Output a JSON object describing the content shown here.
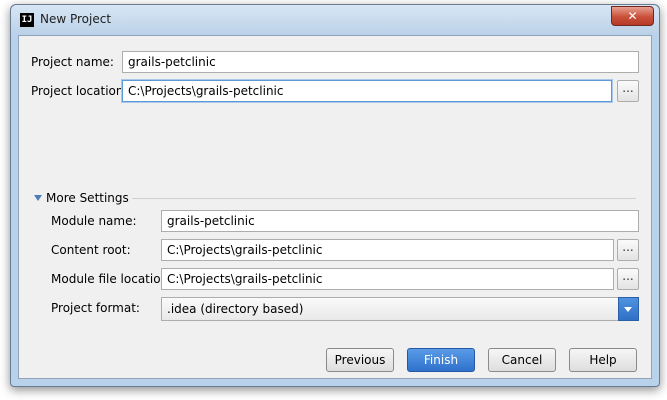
{
  "window": {
    "title": "New Project",
    "app_icon": "IJ",
    "close_glyph": "✕"
  },
  "form": {
    "project_name_label": "Project name:",
    "project_name_value": "grails-petclinic",
    "project_location_label": "Project location:",
    "project_location_value": "C:\\Projects\\grails-petclinic",
    "browse_label": "..."
  },
  "more_settings": {
    "label": "More Settings",
    "module_name_label": "Module name:",
    "module_name_value": "grails-petclinic",
    "content_root_label": "Content root:",
    "content_root_value": "C:\\Projects\\grails-petclinic",
    "module_file_location_label": "Module file location:",
    "module_file_location_value": "C:\\Projects\\grails-petclinic",
    "project_format_label": "Project format:",
    "project_format_value": ".idea (directory based)"
  },
  "buttons": {
    "previous": "Previous",
    "finish": "Finish",
    "cancel": "Cancel",
    "help": "Help"
  },
  "colors": {
    "accent": "#2f71cc",
    "focus_border": "#5b9bd5",
    "close_button": "#c9503a"
  }
}
